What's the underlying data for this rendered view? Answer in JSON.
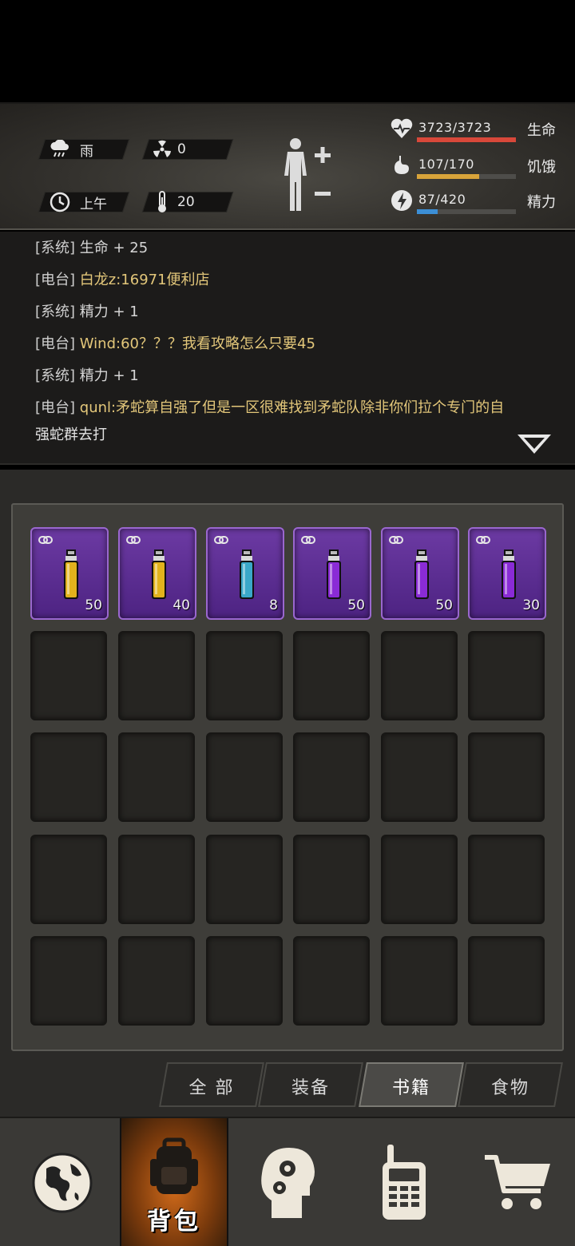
{
  "status": {
    "weather": {
      "icon": "rain-cloud-icon",
      "value": "雨"
    },
    "radiation": {
      "icon": "radiation-icon",
      "value": "0"
    },
    "time": {
      "icon": "clock-icon",
      "value": "上午"
    },
    "temperature": {
      "icon": "thermometer-icon",
      "value": "20"
    },
    "stats": [
      {
        "name": "health",
        "icon": "heart-pulse-icon",
        "value": "3723/3723",
        "label": "生命",
        "fraction": 1.0,
        "color": "#d8483a"
      },
      {
        "name": "hunger",
        "icon": "stomach-icon",
        "value": "107/170",
        "label": "饥饿",
        "fraction": 0.63,
        "color": "#d9a43a"
      },
      {
        "name": "energy",
        "icon": "energy-icon",
        "value": "87/420",
        "label": "精力",
        "fraction": 0.21,
        "color": "#3c8fd6"
      }
    ]
  },
  "chat": {
    "messages": [
      {
        "tag": "[系统]",
        "text": "生命 + 25",
        "kind": "system"
      },
      {
        "tag": "[电台]",
        "text": "白龙z:16971便利店",
        "kind": "radio"
      },
      {
        "tag": "[系统]",
        "text": "精力 + 1",
        "kind": "system"
      },
      {
        "tag": "[电台]",
        "text": "Wind:60？？？我看攻略怎么只要45",
        "kind": "radio"
      },
      {
        "tag": "[系统]",
        "text": "精力 + 1",
        "kind": "system"
      },
      {
        "tag": "[电台]",
        "text": "qunl:矛蛇算自强了但是一区很难找到矛蛇队除非你们拉个专门的自",
        "kind": "radio"
      }
    ],
    "continuation": "强蛇群去打"
  },
  "inventory": {
    "items": [
      {
        "qty": "50",
        "color": "#e2b21c",
        "icon": "potion-vial-icon"
      },
      {
        "qty": "40",
        "color": "#e2b21c",
        "icon": "potion-vial-icon"
      },
      {
        "qty": "8",
        "color": "#3aa8c9",
        "icon": "potion-vial-icon"
      },
      {
        "qty": "50",
        "color": "#8a2bd6",
        "icon": "potion-vial-icon"
      },
      {
        "qty": "50",
        "color": "#8a2bd6",
        "icon": "potion-vial-icon"
      },
      {
        "qty": "30",
        "color": "#8a2bd6",
        "icon": "potion-vial-icon"
      }
    ]
  },
  "tabs": [
    {
      "label": "全 部",
      "active": false
    },
    {
      "label": "装备",
      "active": false
    },
    {
      "label": "书籍",
      "active": true
    },
    {
      "label": "食物",
      "active": false
    }
  ],
  "nav": {
    "items": [
      {
        "name": "world",
        "icon": "globe-icon"
      },
      {
        "name": "backpack",
        "icon": "backpack-icon",
        "label": "背包",
        "active": true
      },
      {
        "name": "skills",
        "icon": "head-gears-icon"
      },
      {
        "name": "radio",
        "icon": "walkie-talkie-icon"
      },
      {
        "name": "shop",
        "icon": "shopping-cart-icon"
      }
    ]
  }
}
